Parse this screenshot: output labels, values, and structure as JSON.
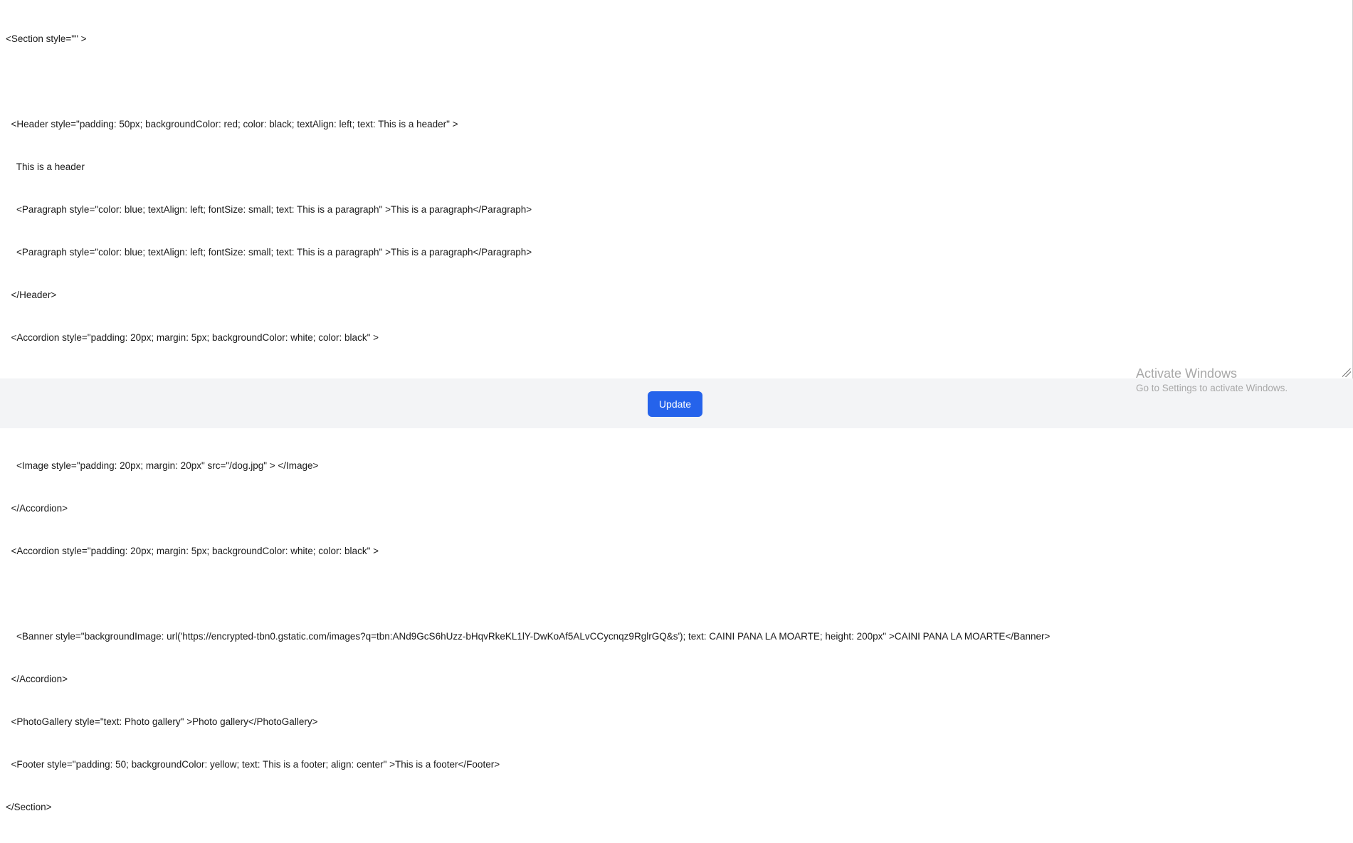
{
  "editor": {
    "lines": [
      "<Section style=\"\" >",
      "",
      "  <Header style=\"padding: 50px; backgroundColor: red; color: black; textAlign: left; text: This is a header\" >",
      "    This is a header",
      "    <Paragraph style=\"color: blue; textAlign: left; fontSize: small; text: This is a paragraph\" >This is a paragraph</Paragraph>",
      "    <Paragraph style=\"color: blue; textAlign: left; fontSize: small; text: This is a paragraph\" >This is a paragraph</Paragraph>",
      "  </Header>",
      "  <Accordion style=\"padding: 20px; margin: 5px; backgroundColor: white; color: black\" >",
      "",
      "    <Image style=\"padding: 20px; margin: 20px\" src=\"/dog.jpg\" > </Image>",
      "    <Image style=\"padding: 20px; margin: 20px\" src=\"/dog.jpg\" > </Image>",
      "  </Accordion>",
      "  <Accordion style=\"padding: 20px; margin: 5px; backgroundColor: white; color: black\" >",
      "",
      "    <Banner style=\"backgroundImage: url('https://encrypted-tbn0.gstatic.com/images?q=tbn:ANd9GcS6hUzz-bHqvRkeKL1lY-DwKoAf5ALvCCycnqz9RglrGQ&s'); text: CAINI PANA LA MOARTE; height: 200px\" >CAINI PANA LA MOARTE</Banner>",
      "  </Accordion>",
      "  <PhotoGallery style=\"text: Photo gallery\" >Photo gallery</PhotoGallery>",
      "  <Footer style=\"padding: 50; backgroundColor: yellow; text: This is a footer; align: center\" >This is a footer</Footer>",
      "</Section>"
    ]
  },
  "actions": {
    "update_label": "Update"
  },
  "watermark": {
    "title": "Activate Windows",
    "subtitle": "Go to Settings to activate Windows."
  },
  "colors": {
    "accent": "#2563eb",
    "bottom_bar": "#f3f4f6",
    "watermark_text": "#a8a8a8"
  }
}
